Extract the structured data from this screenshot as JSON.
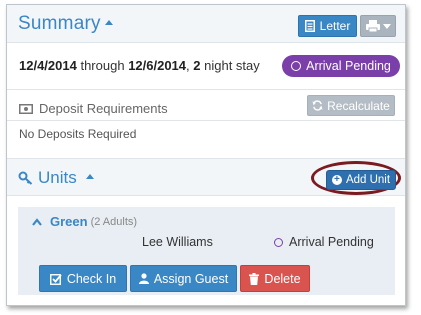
{
  "summary": {
    "title": "Summary",
    "letter_label": "Letter",
    "dates": {
      "start": "12/4/2014",
      "through": "through",
      "end": "12/6/2014",
      "nights": "2",
      "stay_text": "night stay"
    },
    "status_badge": "Arrival Pending",
    "deposit_label": "Deposit Requirements",
    "recalculate_label": "Recalculate",
    "no_deposits": "No Deposits Required"
  },
  "units": {
    "title": "Units",
    "add_unit_label": "Add Unit",
    "items": [
      {
        "name": "Green",
        "guests": "(2 Adults)",
        "guest_name": "Lee Williams",
        "status": "Arrival Pending",
        "actions": {
          "check_in": "Check In",
          "assign_guest": "Assign Guest",
          "delete": "Delete"
        }
      }
    ]
  },
  "colors": {
    "accent_blue": "#3a87c6",
    "status_purple": "#7a3fa8",
    "delete_red": "#d9534f",
    "highlight_ring": "#7a1b22"
  },
  "icons": [
    "caret-up-icon",
    "document-icon",
    "print-icon",
    "caret-down-icon",
    "money-icon",
    "refresh-icon",
    "key-icon",
    "plus-circle-icon",
    "chevron-up-icon",
    "checkbox-check-icon",
    "user-icon",
    "trash-icon"
  ]
}
